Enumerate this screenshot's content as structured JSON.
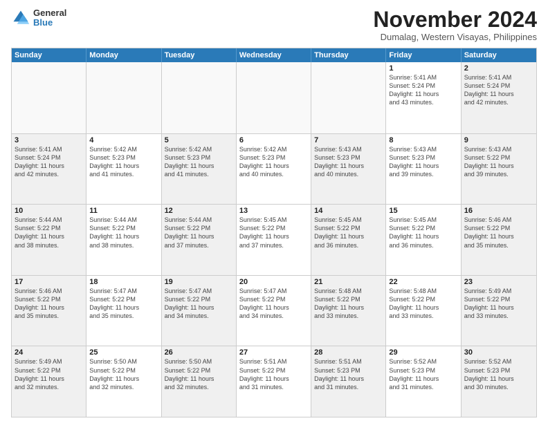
{
  "header": {
    "logo_line1": "General",
    "logo_line2": "Blue",
    "month_title": "November 2024",
    "location": "Dumalag, Western Visayas, Philippines"
  },
  "weekdays": [
    "Sunday",
    "Monday",
    "Tuesday",
    "Wednesday",
    "Thursday",
    "Friday",
    "Saturday"
  ],
  "weeks": [
    [
      {
        "day": "",
        "info": "",
        "empty": true
      },
      {
        "day": "",
        "info": "",
        "empty": true
      },
      {
        "day": "",
        "info": "",
        "empty": true
      },
      {
        "day": "",
        "info": "",
        "empty": true
      },
      {
        "day": "",
        "info": "",
        "empty": true
      },
      {
        "day": "1",
        "info": "Sunrise: 5:41 AM\nSunset: 5:24 PM\nDaylight: 11 hours\nand 43 minutes.",
        "empty": false
      },
      {
        "day": "2",
        "info": "Sunrise: 5:41 AM\nSunset: 5:24 PM\nDaylight: 11 hours\nand 42 minutes.",
        "empty": false
      }
    ],
    [
      {
        "day": "3",
        "info": "Sunrise: 5:41 AM\nSunset: 5:24 PM\nDaylight: 11 hours\nand 42 minutes.",
        "empty": false
      },
      {
        "day": "4",
        "info": "Sunrise: 5:42 AM\nSunset: 5:23 PM\nDaylight: 11 hours\nand 41 minutes.",
        "empty": false
      },
      {
        "day": "5",
        "info": "Sunrise: 5:42 AM\nSunset: 5:23 PM\nDaylight: 11 hours\nand 41 minutes.",
        "empty": false
      },
      {
        "day": "6",
        "info": "Sunrise: 5:42 AM\nSunset: 5:23 PM\nDaylight: 11 hours\nand 40 minutes.",
        "empty": false
      },
      {
        "day": "7",
        "info": "Sunrise: 5:43 AM\nSunset: 5:23 PM\nDaylight: 11 hours\nand 40 minutes.",
        "empty": false
      },
      {
        "day": "8",
        "info": "Sunrise: 5:43 AM\nSunset: 5:23 PM\nDaylight: 11 hours\nand 39 minutes.",
        "empty": false
      },
      {
        "day": "9",
        "info": "Sunrise: 5:43 AM\nSunset: 5:22 PM\nDaylight: 11 hours\nand 39 minutes.",
        "empty": false
      }
    ],
    [
      {
        "day": "10",
        "info": "Sunrise: 5:44 AM\nSunset: 5:22 PM\nDaylight: 11 hours\nand 38 minutes.",
        "empty": false
      },
      {
        "day": "11",
        "info": "Sunrise: 5:44 AM\nSunset: 5:22 PM\nDaylight: 11 hours\nand 38 minutes.",
        "empty": false
      },
      {
        "day": "12",
        "info": "Sunrise: 5:44 AM\nSunset: 5:22 PM\nDaylight: 11 hours\nand 37 minutes.",
        "empty": false
      },
      {
        "day": "13",
        "info": "Sunrise: 5:45 AM\nSunset: 5:22 PM\nDaylight: 11 hours\nand 37 minutes.",
        "empty": false
      },
      {
        "day": "14",
        "info": "Sunrise: 5:45 AM\nSunset: 5:22 PM\nDaylight: 11 hours\nand 36 minutes.",
        "empty": false
      },
      {
        "day": "15",
        "info": "Sunrise: 5:45 AM\nSunset: 5:22 PM\nDaylight: 11 hours\nand 36 minutes.",
        "empty": false
      },
      {
        "day": "16",
        "info": "Sunrise: 5:46 AM\nSunset: 5:22 PM\nDaylight: 11 hours\nand 35 minutes.",
        "empty": false
      }
    ],
    [
      {
        "day": "17",
        "info": "Sunrise: 5:46 AM\nSunset: 5:22 PM\nDaylight: 11 hours\nand 35 minutes.",
        "empty": false
      },
      {
        "day": "18",
        "info": "Sunrise: 5:47 AM\nSunset: 5:22 PM\nDaylight: 11 hours\nand 35 minutes.",
        "empty": false
      },
      {
        "day": "19",
        "info": "Sunrise: 5:47 AM\nSunset: 5:22 PM\nDaylight: 11 hours\nand 34 minutes.",
        "empty": false
      },
      {
        "day": "20",
        "info": "Sunrise: 5:47 AM\nSunset: 5:22 PM\nDaylight: 11 hours\nand 34 minutes.",
        "empty": false
      },
      {
        "day": "21",
        "info": "Sunrise: 5:48 AM\nSunset: 5:22 PM\nDaylight: 11 hours\nand 33 minutes.",
        "empty": false
      },
      {
        "day": "22",
        "info": "Sunrise: 5:48 AM\nSunset: 5:22 PM\nDaylight: 11 hours\nand 33 minutes.",
        "empty": false
      },
      {
        "day": "23",
        "info": "Sunrise: 5:49 AM\nSunset: 5:22 PM\nDaylight: 11 hours\nand 33 minutes.",
        "empty": false
      }
    ],
    [
      {
        "day": "24",
        "info": "Sunrise: 5:49 AM\nSunset: 5:22 PM\nDaylight: 11 hours\nand 32 minutes.",
        "empty": false
      },
      {
        "day": "25",
        "info": "Sunrise: 5:50 AM\nSunset: 5:22 PM\nDaylight: 11 hours\nand 32 minutes.",
        "empty": false
      },
      {
        "day": "26",
        "info": "Sunrise: 5:50 AM\nSunset: 5:22 PM\nDaylight: 11 hours\nand 32 minutes.",
        "empty": false
      },
      {
        "day": "27",
        "info": "Sunrise: 5:51 AM\nSunset: 5:22 PM\nDaylight: 11 hours\nand 31 minutes.",
        "empty": false
      },
      {
        "day": "28",
        "info": "Sunrise: 5:51 AM\nSunset: 5:23 PM\nDaylight: 11 hours\nand 31 minutes.",
        "empty": false
      },
      {
        "day": "29",
        "info": "Sunrise: 5:52 AM\nSunset: 5:23 PM\nDaylight: 11 hours\nand 31 minutes.",
        "empty": false
      },
      {
        "day": "30",
        "info": "Sunrise: 5:52 AM\nSunset: 5:23 PM\nDaylight: 11 hours\nand 30 minutes.",
        "empty": false
      }
    ]
  ]
}
